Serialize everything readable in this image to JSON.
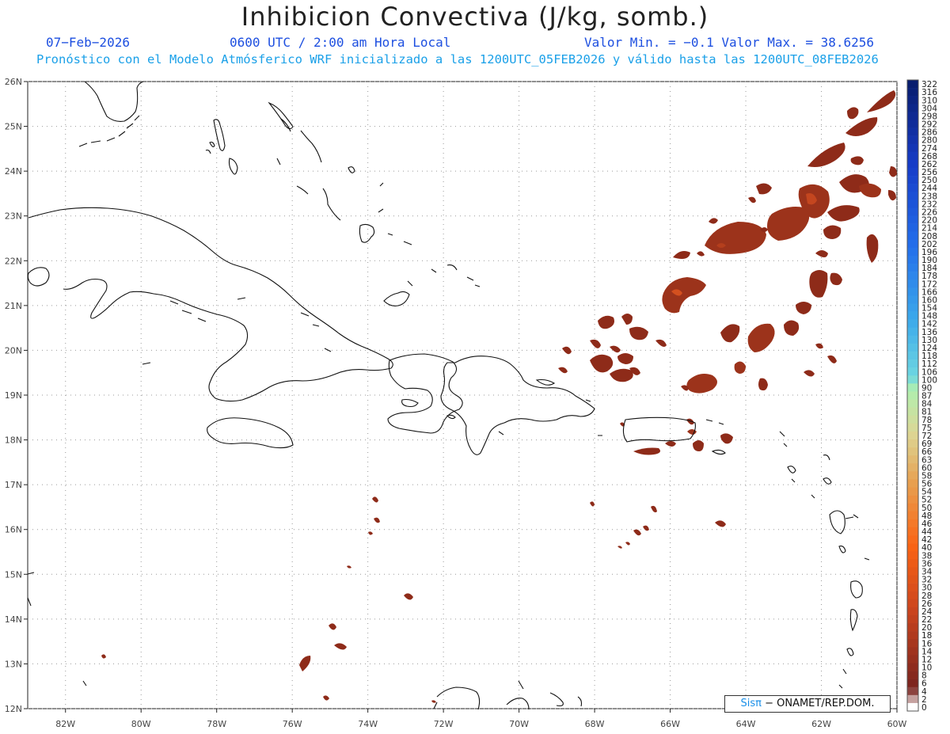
{
  "header": {
    "title": "Inhibicion Convectiva (J/kg, somb.)",
    "date": "07−Feb−2026",
    "time": "0600 UTC / 2:00 am Hora Local",
    "minmax": "Valor Min. = −0.1  Valor Max. = 38.6256",
    "model_info": "Pronóstico con el Modelo Atmósferico WRF inicializado a las 1200UTC_05FEB2026 y válido hasta las  1200UTC_08FEB2026"
  },
  "map": {
    "lon_range": [
      -83.0,
      -60.0
    ],
    "lat_range": [
      12.0,
      26.0
    ],
    "lon_ticks": [
      "82W",
      "80W",
      "78W",
      "76W",
      "74W",
      "72W",
      "70W",
      "68W",
      "66W",
      "64W",
      "62W",
      "60W"
    ],
    "lat_ticks": [
      "12N",
      "13N",
      "14N",
      "15N",
      "16N",
      "17N",
      "18N",
      "19N",
      "20N",
      "21N",
      "22N",
      "23N",
      "24N",
      "25N",
      "26N"
    ]
  },
  "colorbar": {
    "labels": [
      "322",
      "316",
      "310",
      "304",
      "298",
      "292",
      "286",
      "280",
      "274",
      "268",
      "262",
      "256",
      "250",
      "244",
      "238",
      "232",
      "226",
      "220",
      "214",
      "208",
      "202",
      "196",
      "190",
      "184",
      "178",
      "172",
      "166",
      "160",
      "154",
      "148",
      "142",
      "136",
      "130",
      "124",
      "118",
      "112",
      "106",
      "100",
      "90",
      "87",
      "84",
      "81",
      "78",
      "75",
      "72",
      "69",
      "66",
      "63",
      "60",
      "58",
      "56",
      "54",
      "52",
      "50",
      "48",
      "46",
      "44",
      "42",
      "40",
      "38",
      "36",
      "34",
      "32",
      "30",
      "28",
      "26",
      "24",
      "22",
      "20",
      "18",
      "16",
      "14",
      "12",
      "10",
      "8",
      "6",
      "4",
      "2",
      "0"
    ]
  },
  "credit": {
    "logo": "Sisπ",
    "text": "− ONAMET/REP.DOM."
  },
  "colors": {
    "field_dark": "#8c2a18",
    "field_mid": "#a9391c",
    "field_hot": "#e0551e",
    "title_blue": "#1d4fe0",
    "info_cyan": "#1aa0e8"
  }
}
